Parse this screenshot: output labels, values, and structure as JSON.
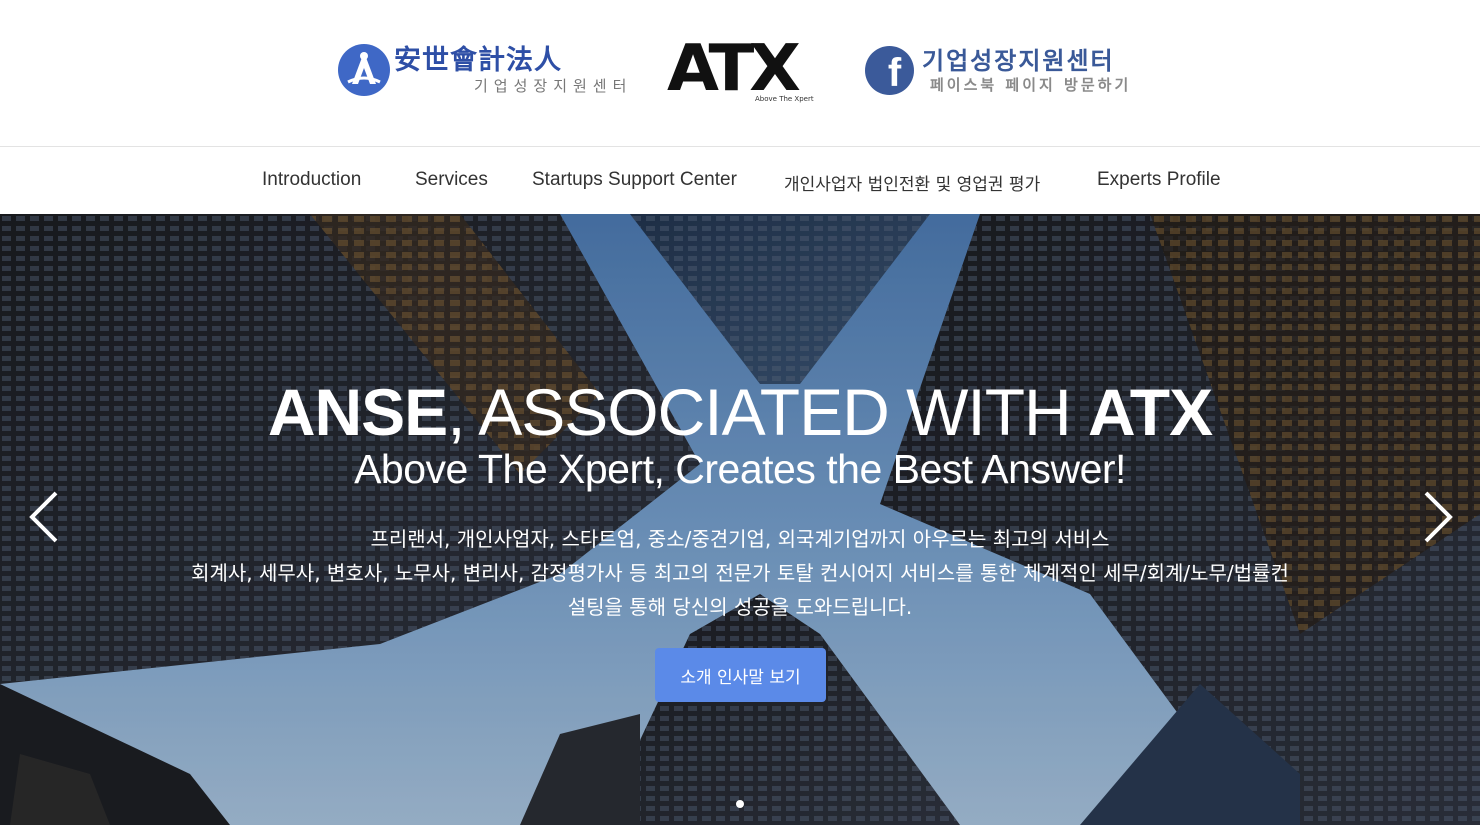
{
  "header": {
    "anse_logo": {
      "title": "安世會計法人",
      "subtitle": "기업성장지원센터"
    },
    "atx_logo": {
      "wordmark": "ATX",
      "tagline": "Above The Xpert"
    },
    "facebook_logo": {
      "title": "기업성장지원센터",
      "subtitle": "페이스북 페이지 방문하기",
      "icon": "facebook-icon"
    }
  },
  "nav": {
    "items": [
      {
        "label": "Introduction"
      },
      {
        "label": "Services"
      },
      {
        "label": "Startups Support Center"
      },
      {
        "label": "개인사업자 법인전환 및 영업권 평가"
      },
      {
        "label": "Experts Profile"
      }
    ]
  },
  "hero": {
    "headline": {
      "part1": "ANSE",
      "part2": ", ASSOCIATED WITH ",
      "part3": "ATX"
    },
    "subheadline": "Above The Xpert, Creates the Best Answer!",
    "description": [
      "프리랜서, 개인사업자, 스타트업, 중소/중견기업, 외국계기업까지 아우르는 최고의 서비스",
      "회계사, 세무사, 변호사, 노무사, 변리사, 감정평가사 등 최고의 전문가 토탈 컨시어지 서비스를 통한 체계적인 세무/회계/노무/법률컨",
      "설팅을 통해 당신의 성공을 도와드립니다."
    ],
    "cta_label": "소개 인사말 보기",
    "prev_icon": "chevron-left-icon",
    "next_icon": "chevron-right-icon",
    "slide_count": 1,
    "active_slide": 1
  },
  "colors": {
    "anse_blue": "#2e4fa6",
    "facebook_blue": "#3b5a9a",
    "cta_blue": "#5b8ae8",
    "sky_blue": "#6f9bcc"
  }
}
